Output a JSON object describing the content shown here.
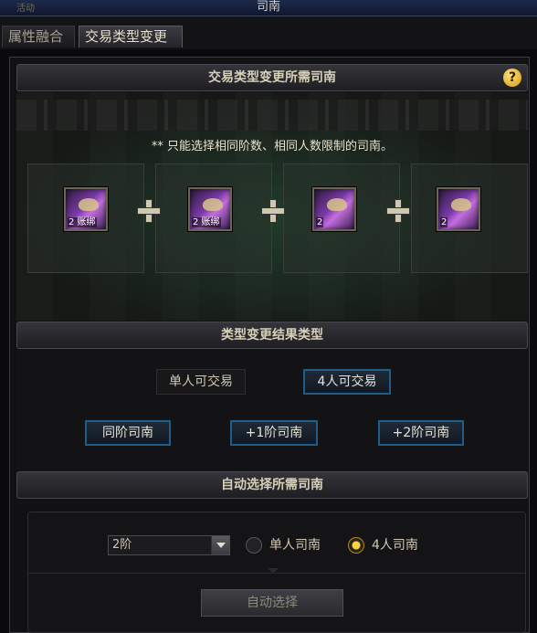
{
  "window": {
    "title": "司南",
    "corner_text": "活动"
  },
  "tabs": [
    {
      "label": "属性融合"
    },
    {
      "label": "交易类型变更"
    }
  ],
  "recipe": {
    "header": "交易类型变更所需司南",
    "help": "?",
    "note": "** 只能选择相同阶数、相同人数限制的司南。",
    "items": [
      {
        "badge": "2 账绑"
      },
      {
        "badge": "2 账绑"
      },
      {
        "badge": "2"
      },
      {
        "badge": "2"
      }
    ]
  },
  "result_type": {
    "header": "类型变更结果类型",
    "trade_single": "单人可交易",
    "trade_four": "4人可交易",
    "same_tier": "同阶司南",
    "plus_one": "+1阶司南",
    "plus_two": "+2阶司南"
  },
  "auto_select": {
    "header": "自动选择所需司南",
    "tier_value": "2阶",
    "radio_single": "单人司南",
    "radio_four": "4人司南",
    "button": "自动选择"
  },
  "colors": {
    "accent_blue": "#1f5e8a",
    "radio_on": "#ffd24a",
    "help": "#d49a10"
  }
}
